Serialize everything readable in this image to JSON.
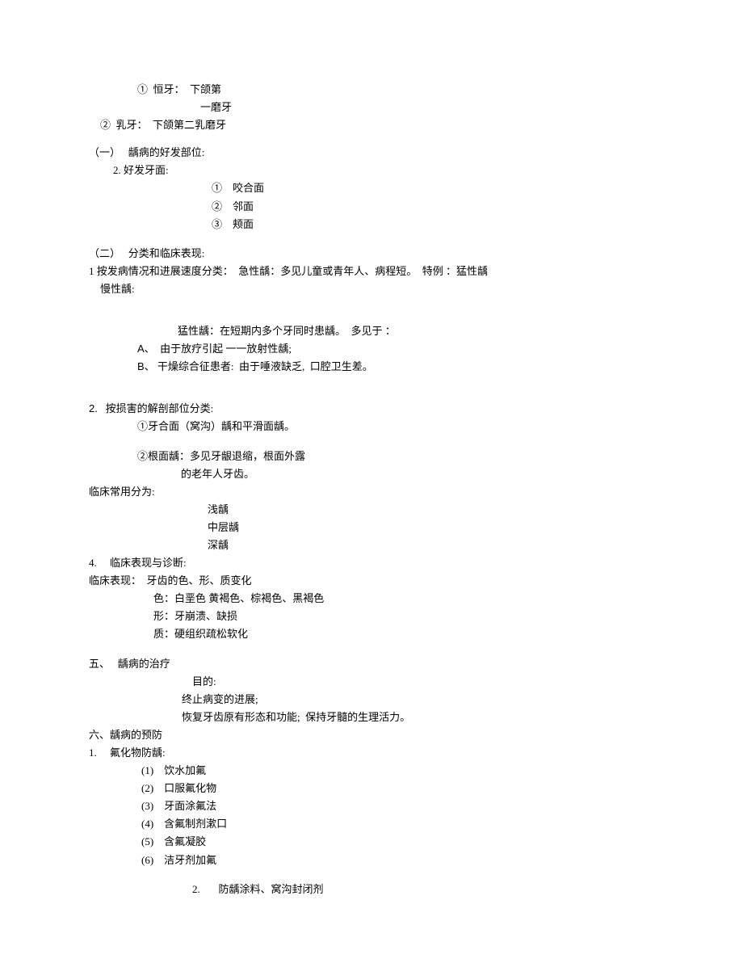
{
  "lines": {
    "t1": "①  恒牙：  下颌第",
    "t2": "一磨牙",
    "t3": "②  乳牙：  下颌第二乳磨牙",
    "h1": "（一）   龋病的好发部位:",
    "t4": "2. 好发牙面:",
    "t5": "①    咬合面",
    "t6": "②    邻面",
    "t7": "③    颊面",
    "h2": "（二）   分类和临床表现:",
    "t8": "1 按发病情况和进展速度分类：  急性龋：多见儿童或青年人、病程短。  特例 ：猛性龋",
    "t9": "慢性龋:",
    "t10": "猛性龋：在短期内多个牙同时患龋。  多见于 ：",
    "t11_a": "A",
    "t11_b": "、  由于放疗引起 一一放射性龋;",
    "t12_a": "B",
    "t12_b": "、 干燥综合征患者:  由于唾液缺乏,  口腔卫生差。",
    "h3_a": "2.",
    "h3_b": "   按损害的解剖部位分类:",
    "t13": "①牙合面（窝沟）龋和平滑面龋。",
    "t14": "②根面龋：多见牙龈退缩，根面外露",
    "t15": "的老年人牙齿。",
    "h4": "临床常用分为:",
    "t16": "浅龋",
    "t17": "中层龋",
    "t18": "深龋",
    "h5": "4.     临床表现与诊断:",
    "t19": "临床表现：  牙齿的色、形、质变化",
    "t20": "色：白垩色 黄褐色、棕褐色、黑褐色",
    "t21": "形：牙崩溃、缺损",
    "t22": "质：硬组织疏松软化",
    "h6": "五、   龋病的治疗",
    "t23": "目的:",
    "t24": "终止病变的进展;",
    "t25": "恢复牙齿原有形态和功能;  保持牙髓的生理活力。",
    "h7": "六、龋病的预防",
    "h8": "1.     氟化物防龋:",
    "t26": "(1)    饮水加氟",
    "t27": "(2)    口服氟化物",
    "t28": "(3)    牙面涂氟法",
    "t29": "(4)    含氟制剂漱口",
    "t30": "(5)    含氟凝胶",
    "t31": "(6)    洁牙剂加氟",
    "h9": "2.       防龋涂料、窝沟封闭剂"
  }
}
